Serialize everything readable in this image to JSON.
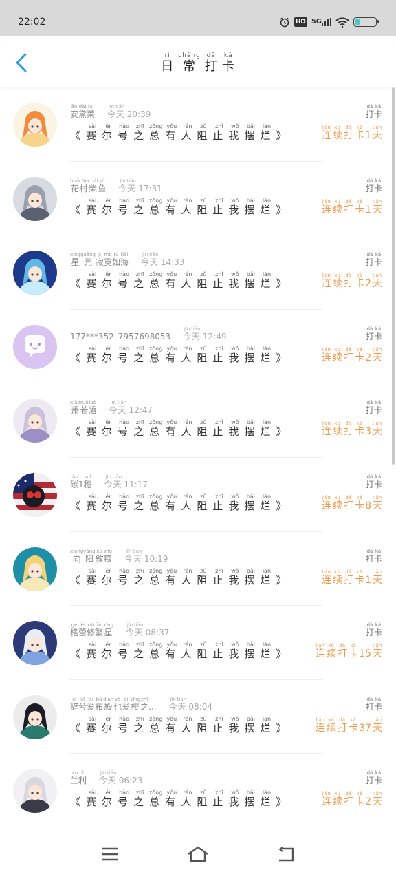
{
  "status": {
    "time": "22:02",
    "network": "5G",
    "hd_label": "HD",
    "battery_percent": 22
  },
  "header": {
    "title": [
      {
        "char": "日",
        "py": "rì"
      },
      {
        "char": "常",
        "py": "cháng"
      },
      {
        "char": "打",
        "py": "dǎ"
      },
      {
        "char": "卡",
        "py": "kǎ"
      }
    ]
  },
  "punch_label": [
    {
      "char": "打",
      "py": "dǎ"
    },
    {
      "char": "卡",
      "py": "kǎ"
    }
  ],
  "book_title": [
    {
      "char": "《",
      "py": ""
    },
    {
      "char": "赛",
      "py": "sài"
    },
    {
      "char": "尔",
      "py": "ěr"
    },
    {
      "char": "号",
      "py": "hào"
    },
    {
      "char": "之",
      "py": "zhī"
    },
    {
      "char": "总",
      "py": "zǒng"
    },
    {
      "char": "有",
      "py": "yǒu"
    },
    {
      "char": "人",
      "py": "rén"
    },
    {
      "char": "阻",
      "py": "zǔ"
    },
    {
      "char": "止",
      "py": "zhǐ"
    },
    {
      "char": "我",
      "py": "wǒ"
    },
    {
      "char": "摆",
      "py": "bǎi"
    },
    {
      "char": "烂",
      "py": "làn"
    },
    {
      "char": "》",
      "py": ""
    }
  ],
  "streak_prefix": [
    {
      "char": "连",
      "py": "lián"
    },
    {
      "char": "续",
      "py": "xù"
    },
    {
      "char": "打",
      "py": "dǎ"
    },
    {
      "char": "卡",
      "py": "kǎ"
    }
  ],
  "streak_suffix": {
    "char": "天",
    "py": "tiān"
  },
  "today": [
    {
      "char": "今",
      "py": "jīn"
    },
    {
      "char": "天",
      "py": "tiān"
    }
  ],
  "entries": [
    {
      "name": [
        {
          "char": "安",
          "py": "ān"
        },
        {
          "char": "黛",
          "py": "dài"
        },
        {
          "char": "莱",
          "py": "lái"
        }
      ],
      "time": "20:39",
      "days": "1",
      "avatar": {
        "kind": "girl-orange",
        "bg": "#fbf3e4",
        "hair": "#f08c3c",
        "accent": "#f7d48a"
      }
    },
    {
      "name": [
        {
          "char": "花",
          "py": "huā"
        },
        {
          "char": "村",
          "py": "cūn"
        },
        {
          "char": "柴",
          "py": "chái"
        },
        {
          "char": "鱼",
          "py": "yú"
        }
      ],
      "time": "17:31",
      "days": "1",
      "avatar": {
        "kind": "gray",
        "bg": "#d8dbe2",
        "hair": "#9aa0ad",
        "accent": "#5b6170"
      }
    },
    {
      "name": [
        {
          "char": "星",
          "py": "xīng"
        },
        {
          "char": "光",
          "py": "guāng"
        },
        {
          "char": "寂",
          "py": "jì"
        },
        {
          "char": "寞",
          "py": "mò"
        },
        {
          "char": "如",
          "py": "rú"
        },
        {
          "char": "海",
          "py": "hǎi"
        }
      ],
      "time": "14:33",
      "days": "2",
      "avatar": {
        "kind": "blue",
        "bg": "#1e3a8a",
        "hair": "#5fb8e6",
        "accent": "#c7ecff"
      }
    },
    {
      "name_plain": "177***352_7957698053",
      "time": "12:49",
      "days": "2",
      "avatar": {
        "kind": "default",
        "bg": "#d9c4f2",
        "hair": "#ffffff",
        "accent": "#b08fd6"
      }
    },
    {
      "name": [
        {
          "char": "萧",
          "py": "xiāo"
        },
        {
          "char": "若",
          "py": "ruò"
        },
        {
          "char": "落",
          "py": "luò"
        }
      ],
      "time": "12:47",
      "days": "3",
      "avatar": {
        "kind": "silver",
        "bg": "#eeeaf4",
        "hair": "#c9c2d8",
        "accent": "#9c8fc4"
      }
    },
    {
      "name": [
        {
          "char": "碳",
          "py": "tàn"
        },
        {
          "char": "1",
          "py": ""
        },
        {
          "char": "穗",
          "py": "suì"
        }
      ],
      "time": "11:17",
      "days": "8",
      "avatar": {
        "kind": "flag",
        "bg": "#b32a37",
        "hair": "#1d2a6b",
        "accent": "#ffffff"
      }
    },
    {
      "name": [
        {
          "char": "向",
          "py": "xiàng"
        },
        {
          "char": "阳",
          "py": "yáng"
        },
        {
          "char": "敘",
          "py": "xù"
        },
        {
          "char": "糠",
          "py": "shū"
        }
      ],
      "time": "10:19",
      "days": "1",
      "avatar": {
        "kind": "gold",
        "bg": "#1f8fa8",
        "hair": "#f3d27a",
        "accent": "#f7e9b5"
      }
    },
    {
      "name": [
        {
          "char": "格",
          "py": "gé"
        },
        {
          "char": "蕾",
          "py": "lěi"
        },
        {
          "char": "修",
          "py": "xiū"
        },
        {
          "char": "繁",
          "py": "fán"
        },
        {
          "char": "星",
          "py": "xīng"
        }
      ],
      "time": "08:37",
      "days": "15",
      "avatar": {
        "kind": "white-blue",
        "bg": "#2c3b78",
        "hair": "#e8eef8",
        "accent": "#7fa2e0"
      }
    },
    {
      "name": [
        {
          "char": "辞",
          "py": "cí"
        },
        {
          "char": "兮",
          "py": "xī"
        },
        {
          "char": "爱",
          "py": "ài"
        },
        {
          "char": "布",
          "py": "bù"
        },
        {
          "char": "殿",
          "py": "diàn"
        },
        {
          "char": "也",
          "py": "yě"
        },
        {
          "char": "爱",
          "py": "ài"
        },
        {
          "char": "樱",
          "py": "yīng"
        },
        {
          "char": "之",
          "py": "zhī"
        },
        {
          "char": "...",
          "py": ""
        }
      ],
      "time": "08:04",
      "days": "37",
      "avatar": {
        "kind": "dark",
        "bg": "#ececec",
        "hair": "#1c1c24",
        "accent": "#2a7a6f"
      }
    },
    {
      "name": [
        {
          "char": "兰",
          "py": "lán"
        },
        {
          "char": "利",
          "py": "lì"
        }
      ],
      "time": "06:23",
      "days": "2",
      "avatar": {
        "kind": "white-hair",
        "bg": "#f1f1f3",
        "hair": "#d8d8de",
        "accent": "#3a3a48"
      }
    }
  ],
  "colors": {
    "accent": "#2f9bdc",
    "streak": "#f2994a",
    "status_bg": "#d9d9d9"
  },
  "nav": {
    "icons": [
      "menu-icon",
      "home-icon",
      "back-icon"
    ]
  }
}
